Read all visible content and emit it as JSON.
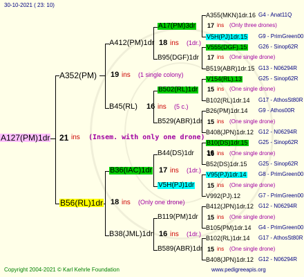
{
  "header": {
    "date": "30-10-2021 ( 23: 10)"
  },
  "footer": {
    "copyright": "Copyright 2004-2021 © Karl Kehrle Foundation",
    "url": "www.pedigreeapis.org"
  },
  "colors": {
    "text": "#000000",
    "ins": "#cc0000",
    "annotation": "#a000a0",
    "sire_code": "#000080",
    "green_bg": "#00cc00",
    "cyan_bg": "#00ffff",
    "yellow_bg": "#ffff00",
    "pink_bg": "#ffc0ff"
  },
  "root": {
    "name": "A127(PM)1dr",
    "ins_num": "21",
    "ins_word": "ins",
    "note": "(Insem. with only one drone)"
  },
  "gen1": [
    {
      "name": "A352(PM)",
      "ins_num": "19",
      "ins_word": "ins",
      "note": "(1 single colony)"
    },
    {
      "name": "B56(RL)1dr",
      "ins_num": "18",
      "ins_word": "ins",
      "note": "(Only one drone)"
    }
  ],
  "gen2": [
    {
      "name": "A412(PM)1dr",
      "ins_num": "18",
      "ins_word": "ins",
      "note": "(1dr.)"
    },
    {
      "name": "B45(RL)",
      "ins_num": "16",
      "ins_word": "ins",
      "note": "(5 c.)"
    },
    {
      "name": "B36(IAC)1dr",
      "ins_num": "17",
      "ins_word": "ins",
      "note": "(1dr.)"
    },
    {
      "name": "B38(JML)1dr",
      "ins_num": "16",
      "ins_word": "ins",
      "note": "(1dr.)"
    }
  ],
  "gen3": [
    {
      "name": "A17(PM)3dr"
    },
    {
      "name": "B95(DGF)1dr"
    },
    {
      "name": "B502(RL)1dr"
    },
    {
      "name": "B529(ABR)1dr"
    },
    {
      "name": "B44(DS)1dr",
      "ins_num": "16",
      "ins_word": "ins",
      "note": "(1dr.)"
    },
    {
      "name": "V5H(PJ)1dr"
    },
    {
      "name": "B119(PM)1dr"
    },
    {
      "name": "B589(ABR)1dr"
    }
  ],
  "gen4": [
    {
      "name": "A355(MKN)1dr.16",
      "code": "G4 - Anat11Q"
    },
    {
      "ins_num": "17",
      "ins_word": "ins",
      "note": "(Only three drones)"
    },
    {
      "name": "V5H(PJ)1dr.15",
      "code": "G9 - PrimGreen00"
    },
    {
      "name": "V555(DGF).15",
      "code": "G26 - Sinop62R"
    },
    {
      "ins_num": "17",
      "ins_word": "ins",
      "note": "(One single drone)"
    },
    {
      "name": "B519(ABR)1dr.15",
      "code": "G13 - N06294R"
    },
    {
      "name": "V154(RL).13",
      "code": "G25 - Sinop62R"
    },
    {
      "ins_num": "15",
      "ins_word": "ins",
      "note": "(One single drone)"
    },
    {
      "name": "B102(RL)1dr.14",
      "code": "G17 - AthosSt80R"
    },
    {
      "name": "B26(PM)1dr.14",
      "code": "G9 - Athos00R"
    },
    {
      "ins_num": "15",
      "ins_word": "ins",
      "note": "(One single drone)"
    },
    {
      "name": "B408(JPN)1dr.12",
      "code": "G12 - N06294R"
    },
    {
      "name": "B10(DS)1dr.15",
      "code": "G25 - Sinop62R"
    },
    {
      "ins_num": "16",
      "ins_word": "ins",
      "note": "(One single drone)"
    },
    {
      "name": "B52(DS)1dr.15",
      "code": "G25 - Sinop62R"
    },
    {
      "name": "V95(PJ)1dr.14",
      "code": "G8 - PrimGreen00"
    },
    {
      "ins_num": "15",
      "ins_word": "ins",
      "note": "(One single drone)"
    },
    {
      "name": "V992(PJ).12",
      "code": "G7 - PrimGreen00"
    },
    {
      "name": "B412(JPN)1dr.12",
      "code": "G12 - N06294R"
    },
    {
      "ins_num": "15",
      "ins_word": "ins",
      "note": "(One single drone)"
    },
    {
      "name": "B105(PM)1dr.14",
      "code": "G4 - PrimGreen00"
    },
    {
      "name": "B102(RL)1dr.14",
      "code": "G17 - AthosSt80R"
    },
    {
      "ins_num": "15",
      "ins_word": "ins",
      "note": "(One single drone)"
    },
    {
      "name": "B408(JPN)1dr.12",
      "code": "G12 - N06294R"
    }
  ]
}
